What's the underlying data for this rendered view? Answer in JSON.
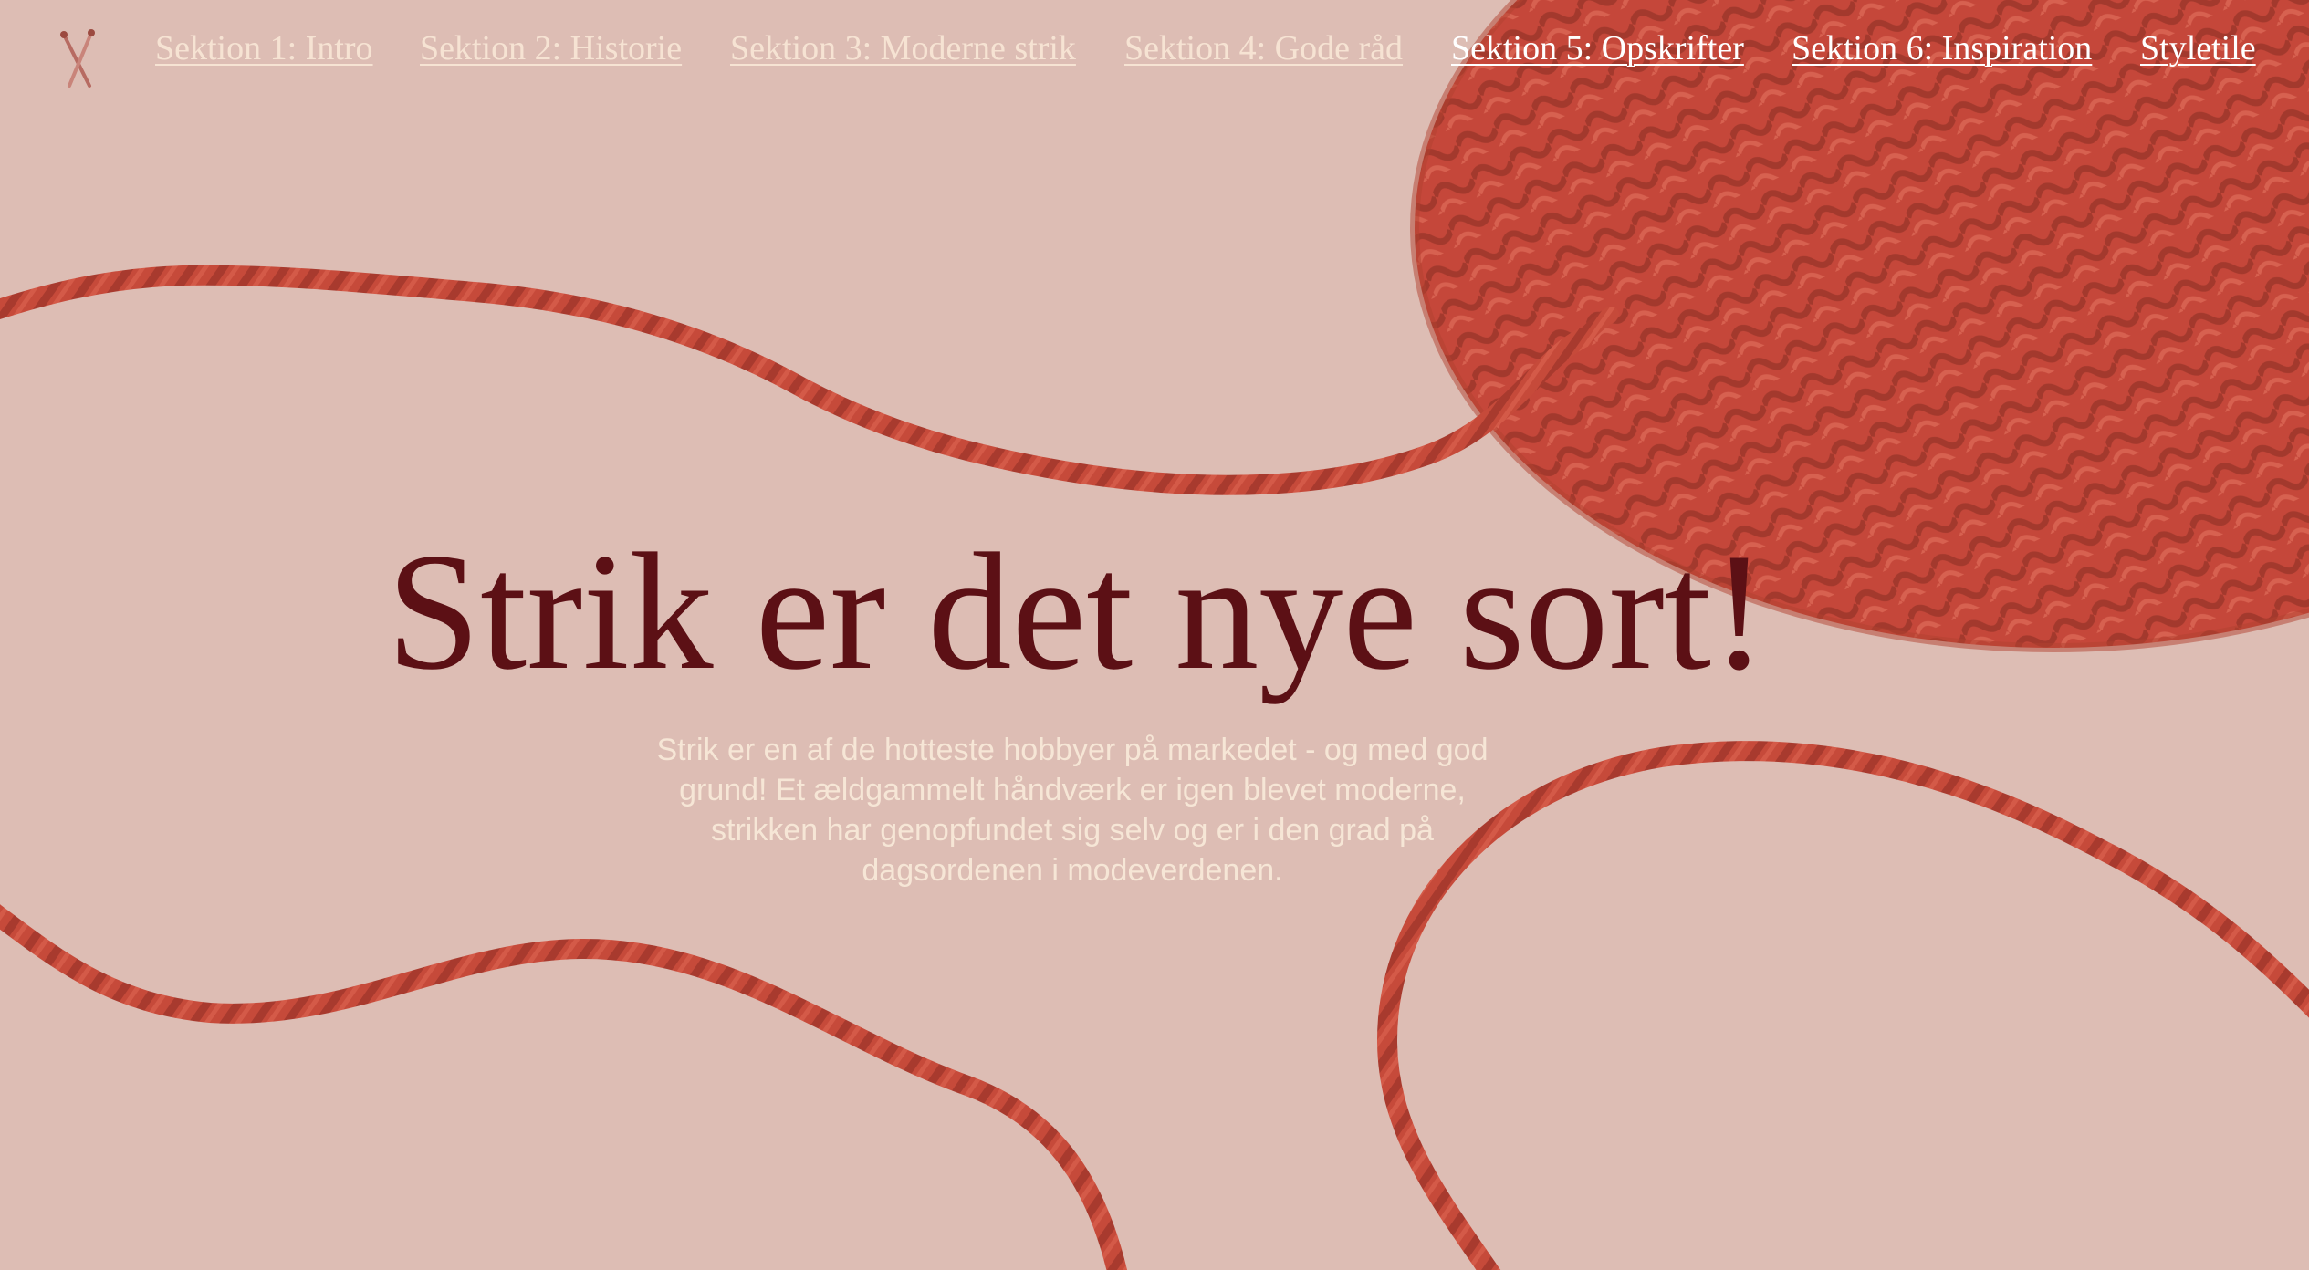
{
  "logo": {
    "icon": "knitting-needles-icon"
  },
  "nav": {
    "items": [
      {
        "label": "Sektion 1: Intro"
      },
      {
        "label": "Sektion 2: Historie"
      },
      {
        "label": "Sektion 3: Moderne strik"
      },
      {
        "label": "Sektion 4: Gode råd"
      },
      {
        "label": "Sektion 5: Opskrifter"
      },
      {
        "label": "Sektion 6: Inspiration"
      },
      {
        "label": "Styletile"
      }
    ]
  },
  "hero": {
    "title": "Strik er det nye sort!",
    "lead": "Strik er en af de hotteste hobbyer på markedet - og med god grund! Et ældgammelt håndværk er igen blevet moderne, strikken har genopfundet sig selv og er i den grad på dagsordenen i modeverdenen."
  },
  "colors": {
    "background": "#ddbdb4",
    "yarn": "#c64a3a",
    "title": "#5c1015",
    "lead_text": "#f6e6d6",
    "nav_text": "#f6e3d3"
  }
}
